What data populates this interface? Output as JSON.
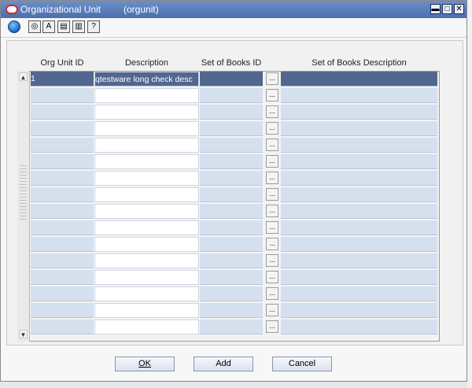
{
  "window": {
    "title": "Organizational Unit",
    "subtitle": "(orgunit)",
    "controls": [
      "▬",
      "□",
      "✕"
    ]
  },
  "toolbar": {
    "globe_icon": "globe-icon",
    "icons": [
      "help-icon",
      "spellcheck-icon",
      "notes-icon",
      "print-icon",
      "question-icon"
    ]
  },
  "table": {
    "headers": [
      "Org Unit ID",
      "Description",
      "Set of Books ID",
      "Set of Books Description"
    ],
    "rows": [
      {
        "org_unit_id": "1",
        "description": "qtestware long check desc",
        "set_of_books_id": "",
        "set_of_books_description": ""
      },
      {
        "org_unit_id": "",
        "description": "",
        "set_of_books_id": "",
        "set_of_books_description": ""
      },
      {
        "org_unit_id": "",
        "description": "",
        "set_of_books_id": "",
        "set_of_books_description": ""
      },
      {
        "org_unit_id": "",
        "description": "",
        "set_of_books_id": "",
        "set_of_books_description": ""
      },
      {
        "org_unit_id": "",
        "description": "",
        "set_of_books_id": "",
        "set_of_books_description": ""
      },
      {
        "org_unit_id": "",
        "description": "",
        "set_of_books_id": "",
        "set_of_books_description": ""
      },
      {
        "org_unit_id": "",
        "description": "",
        "set_of_books_id": "",
        "set_of_books_description": ""
      },
      {
        "org_unit_id": "",
        "description": "",
        "set_of_books_id": "",
        "set_of_books_description": ""
      },
      {
        "org_unit_id": "",
        "description": "",
        "set_of_books_id": "",
        "set_of_books_description": ""
      },
      {
        "org_unit_id": "",
        "description": "",
        "set_of_books_id": "",
        "set_of_books_description": ""
      },
      {
        "org_unit_id": "",
        "description": "",
        "set_of_books_id": "",
        "set_of_books_description": ""
      },
      {
        "org_unit_id": "",
        "description": "",
        "set_of_books_id": "",
        "set_of_books_description": ""
      },
      {
        "org_unit_id": "",
        "description": "",
        "set_of_books_id": "",
        "set_of_books_description": ""
      },
      {
        "org_unit_id": "",
        "description": "",
        "set_of_books_id": "",
        "set_of_books_description": ""
      },
      {
        "org_unit_id": "",
        "description": "",
        "set_of_books_id": "",
        "set_of_books_description": ""
      },
      {
        "org_unit_id": "",
        "description": "",
        "set_of_books_id": "",
        "set_of_books_description": ""
      }
    ],
    "ellipsis": "..."
  },
  "buttons": {
    "ok": "OK",
    "add": "Add",
    "cancel": "Cancel"
  },
  "colors": {
    "title_bar": "#4a6fae",
    "row_fill": "#d5e0ef",
    "selected_row": "#51678f"
  }
}
